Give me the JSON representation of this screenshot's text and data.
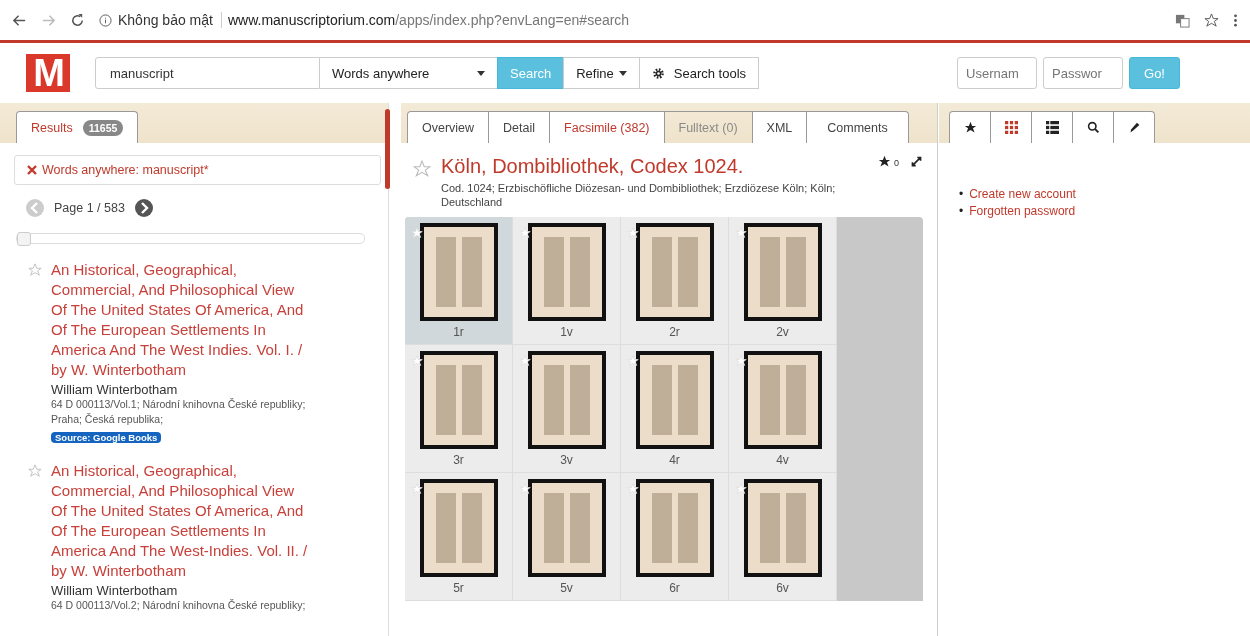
{
  "browser": {
    "security": "Không bảo mật",
    "url_host": "www.manuscriptorium.com",
    "url_path": "/apps/index.php?envLang=en#search"
  },
  "header": {
    "logo": "M",
    "search": {
      "value": "manuscript"
    },
    "field_select": "Words anywhere",
    "buttons": [
      "Search",
      "Refine",
      "Search tools"
    ],
    "login": {
      "username_placeholder": "Usernam",
      "password_placeholder": "Passwor",
      "button": "Go!"
    }
  },
  "results_panel": {
    "tab": {
      "label": "Results",
      "count": "11655"
    },
    "filter": "Words anywhere: manuscript*",
    "pager": {
      "text": "Page 1 / 583",
      "prev_disabled": true,
      "next_disabled": false
    },
    "slider": {
      "level": 0.0
    },
    "results": [
      {
        "title": "An Historical, Geographical, Commercial, And Philosophical View Of The United States Of America, And Of The European Settlements In America And The West Indies. Vol. I. / by W. Winterbotham",
        "author": "William Winterbotham",
        "details": [
          "64 D 000113/Vol.1; Národní knihovna České republiky;",
          "Praha; Česká republika;"
        ],
        "source": "Source: Google Books",
        "starred": false
      },
      {
        "title": "An Historical, Geographical, Commercial, And Philosophical View Of The United States Of America, And Of The European Settlements In America And The West-Indies. Vol. II. / by W. Winterbotham",
        "author": "William Winterbotham",
        "details": [
          "64 D 000113/Vol.2; Národní knihovna České republiky;"
        ],
        "starred": false
      }
    ]
  },
  "record_panel": {
    "tabs": [
      {
        "label": "Overview",
        "selected": false,
        "disabled": false
      },
      {
        "label": "Detail",
        "selected": false,
        "disabled": false
      },
      {
        "label": "Facsimile (382)",
        "selected": true,
        "disabled": false
      },
      {
        "label": "Fulltext (0)",
        "selected": false,
        "disabled": true
      },
      {
        "label": "XML",
        "selected": false,
        "disabled": false
      },
      {
        "label": "Comments",
        "selected": false,
        "disabled": false
      }
    ],
    "title": "Köln, Dombibliothek, Codex 1024.",
    "starred": false,
    "rating": "0",
    "subtitle": "Cod. 1024; Erzbischöfliche Diözesan- und Dombibliothek; Erzdiözese Köln; Köln; Deutschland",
    "pages": [
      {
        "label": "1r",
        "selected": true
      },
      {
        "label": "1v",
        "selected": false
      },
      {
        "label": "2r",
        "selected": false
      },
      {
        "label": "2v",
        "selected": false
      },
      {
        "label": "3r",
        "selected": false
      },
      {
        "label": "3v",
        "selected": false
      },
      {
        "label": "4r",
        "selected": false
      },
      {
        "label": "4v",
        "selected": false
      },
      {
        "label": "5r",
        "selected": false
      },
      {
        "label": "5v",
        "selected": false
      },
      {
        "label": "6r",
        "selected": false
      },
      {
        "label": "6v",
        "selected": false
      }
    ]
  },
  "side_panel": {
    "tabs": [
      {
        "kind": "star",
        "selected": false
      },
      {
        "kind": "grid",
        "selected": true
      },
      {
        "kind": "list",
        "selected": false
      },
      {
        "kind": "search",
        "selected": false
      },
      {
        "kind": "pencil",
        "selected": false
      }
    ],
    "links": [
      {
        "bullet": "•",
        "label": "Create new account"
      },
      {
        "bullet": "•",
        "label": "Forgotten password"
      }
    ]
  }
}
